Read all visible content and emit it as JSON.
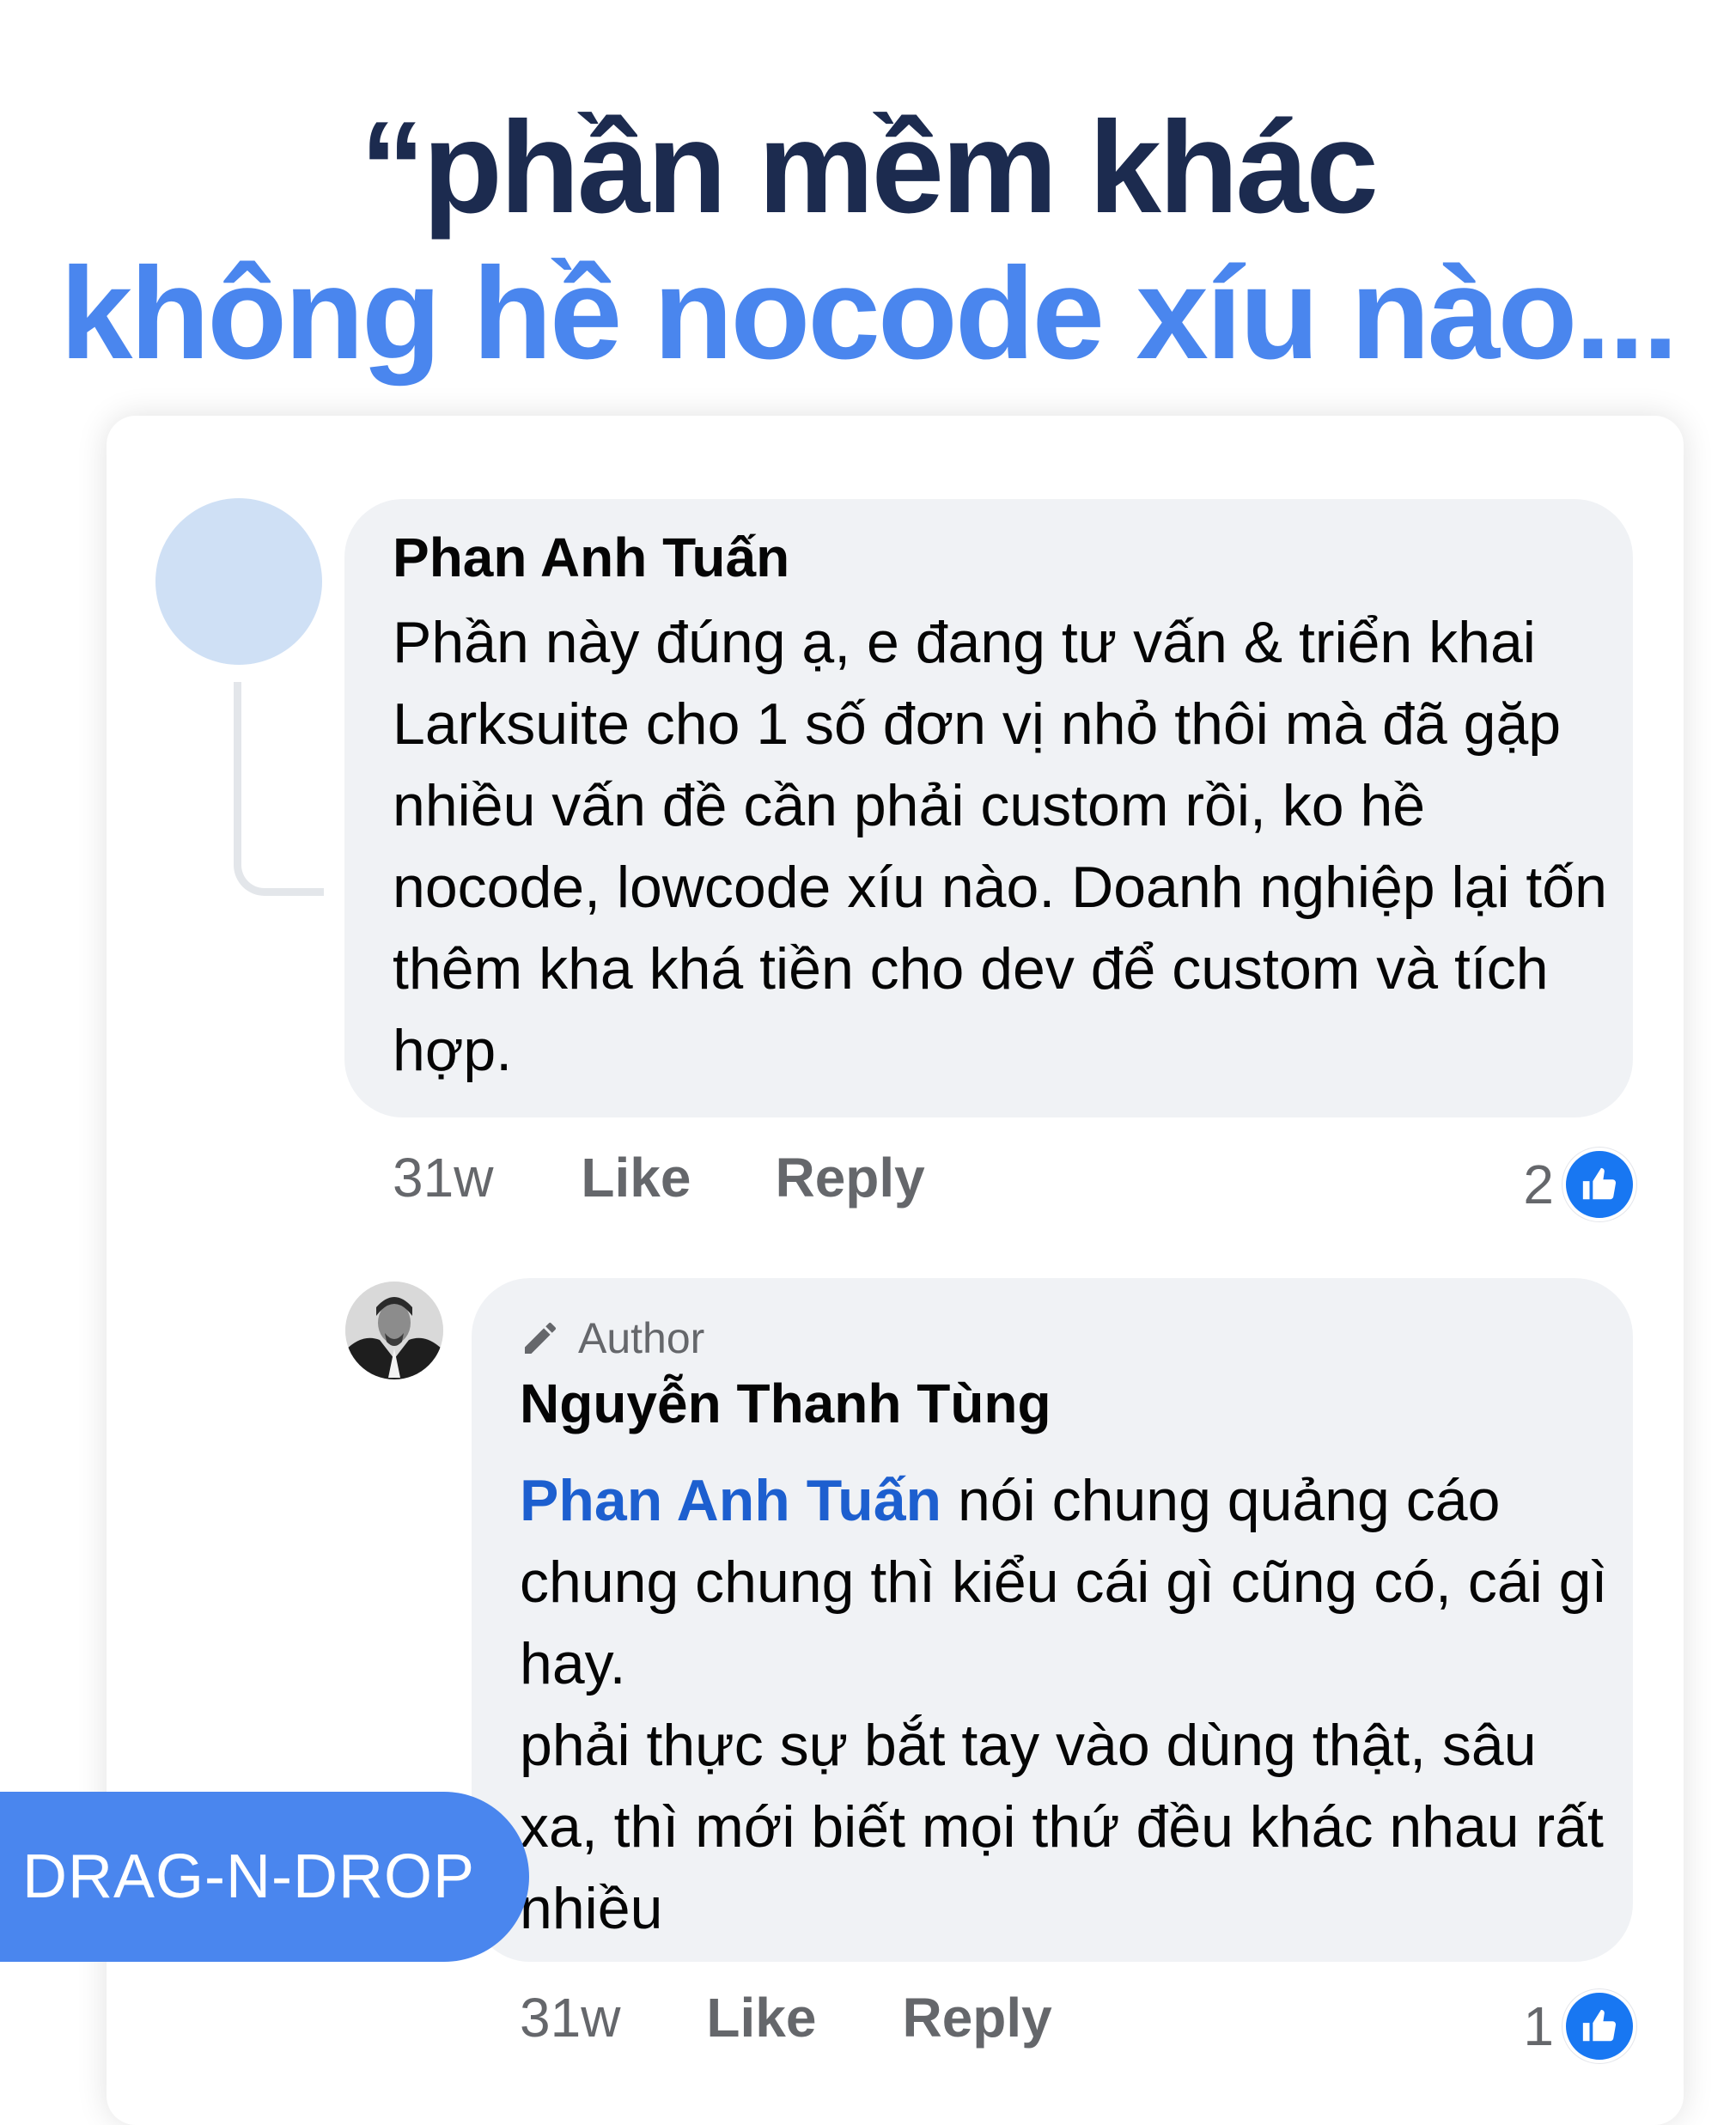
{
  "headline": {
    "line1": "“phần mềm khác",
    "line2": "không hề nocode xíu nào..."
  },
  "comments": [
    {
      "author": "Phan Anh Tuấn",
      "text": "Phần này đúng ạ, e đang tư vấn & triển khai Larksuite cho 1 số đơn vị nhỏ thôi mà đã gặp nhiều vấn đề cần phải custom rồi, ko hề nocode, lowcode xíu nào. Doanh nghiệp lại tốn thêm kha khá tiền cho dev để custom và tích hợp.",
      "time": "31w",
      "like_label": "Like",
      "reply_label": "Reply",
      "reaction_count": "2"
    }
  ],
  "reply": {
    "tag": "Author",
    "author": "Nguyễn Thanh Tùng",
    "mention": "Phan Anh Tuấn",
    "text_line1": " nói chung quảng cáo chung chung thì kiểu cái gì cũng có, cái gì hay.",
    "text_line2": "phải thực sự bắt tay vào dùng thật, sâu xa, thì mới biết mọi thứ đều khác nhau rất nhiều",
    "time": "31w",
    "like_label": "Like",
    "reply_label": "Reply",
    "reaction_count": "1"
  },
  "badge": {
    "label": "DRAG-N-DROP"
  },
  "icons": {
    "pencil": "pencil-icon",
    "like": "thumbs-up-icon",
    "like_color": "#1877f2"
  },
  "colors": {
    "headline_dark": "#1c2b4f",
    "headline_blue": "#4a86ee",
    "bubble": "#f0f2f5",
    "mention": "#1d5fcf",
    "meta": "#65676b"
  }
}
